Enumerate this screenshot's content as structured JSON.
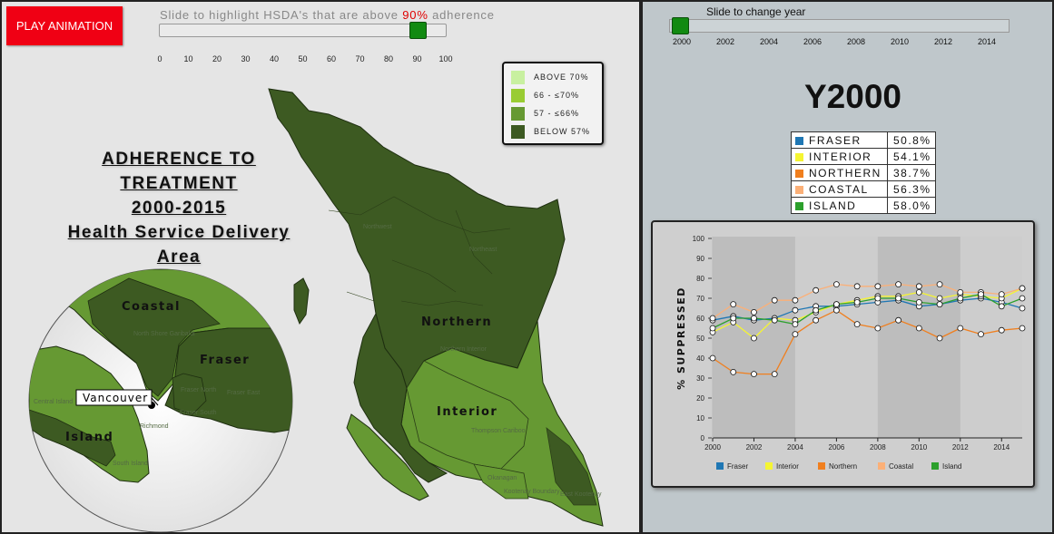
{
  "controls": {
    "play_label": "PLAY ANIMATION",
    "adherence_caption_pre": "Slide to highlight HSDA's that are above ",
    "adherence_caption_value": "90%",
    "adherence_caption_post": " adherence",
    "adherence_slider_value": 90,
    "adherence_ticks": [
      "0",
      "10",
      "20",
      "30",
      "40",
      "50",
      "60",
      "70",
      "80",
      "90",
      "100"
    ],
    "year_caption": "Slide to change year",
    "year_slider_value": 2000,
    "year_ticks": [
      "2000",
      "2002",
      "2004",
      "2006",
      "2008",
      "2010",
      "2012",
      "2014"
    ]
  },
  "legend": {
    "items": [
      {
        "label": "ABOVE 70%",
        "color": "#c8f0a0"
      },
      {
        "label": "66 - ≤70%",
        "color": "#99cc33"
      },
      {
        "label": "57 - ≤66%",
        "color": "#669933"
      },
      {
        "label": "BELOW 57%",
        "color": "#3d5a22"
      }
    ]
  },
  "map": {
    "title_lines": [
      "ADHERENCE TO",
      "TREATMENT",
      "2000-2015",
      "Health Service Delivery",
      "Area"
    ],
    "region_labels": {
      "northern": "Northern",
      "interior": "Interior",
      "coastal": "Coastal",
      "fraser": "Fraser",
      "island": "Island",
      "vancouver": "Vancouver"
    },
    "small_labels": [
      "Northwest",
      "Northeast",
      "Northern Interior",
      "Thompson Cariboo",
      "Okanagan",
      "Kootenay Boundary",
      "East Kootenay",
      "North Shore Garibaldi",
      "Fraser North",
      "Fraser East",
      "Fraser South",
      "Richmond",
      "Central Island",
      "South Island"
    ]
  },
  "year_display": "Y2000",
  "regions": [
    {
      "name": "FRASER",
      "value": "50.8%",
      "color": "#1f77b4"
    },
    {
      "name": "INTERIOR",
      "value": "54.1%",
      "color": "#f5f532"
    },
    {
      "name": "NORTHERN",
      "value": "38.7%",
      "color": "#f07f1e"
    },
    {
      "name": "COASTAL",
      "value": "56.3%",
      "color": "#fbb078"
    },
    {
      "name": "ISLAND",
      "value": "58.0%",
      "color": "#2ca02c"
    }
  ],
  "chart_data": {
    "type": "line",
    "ylabel": "% SUPPRESSED",
    "xlabel": "",
    "ylim": [
      0,
      100
    ],
    "xlim": [
      2000,
      2015
    ],
    "y_ticks": [
      0,
      10,
      20,
      30,
      40,
      50,
      60,
      70,
      80,
      90,
      100
    ],
    "x_ticks": [
      2000,
      2002,
      2004,
      2006,
      2008,
      2010,
      2012,
      2014
    ],
    "shaded_bands": [
      [
        2000,
        2004
      ],
      [
        2008,
        2012
      ]
    ],
    "x": [
      2000,
      2001,
      2002,
      2003,
      2004,
      2005,
      2006,
      2007,
      2008,
      2009,
      2010,
      2011,
      2012,
      2013,
      2014,
      2015
    ],
    "series": [
      {
        "name": "Fraser",
        "color": "#1f77b4",
        "values": [
          59,
          61,
          59,
          60,
          64,
          66,
          66,
          67,
          68,
          69,
          66,
          67,
          69,
          70,
          68,
          65
        ]
      },
      {
        "name": "Interior",
        "color": "#f5f532",
        "values": [
          53,
          58,
          50,
          60,
          59,
          63,
          67,
          69,
          71,
          71,
          73,
          70,
          72,
          71,
          70,
          75
        ]
      },
      {
        "name": "Northern",
        "color": "#f07f1e",
        "values": [
          40,
          33,
          32,
          32,
          52,
          59,
          64,
          57,
          55,
          59,
          55,
          50,
          55,
          52,
          54,
          55
        ]
      },
      {
        "name": "Coastal",
        "color": "#fbb078",
        "values": [
          60,
          67,
          63,
          69,
          69,
          74,
          77,
          76,
          76,
          77,
          76,
          77,
          73,
          73,
          72,
          75
        ]
      },
      {
        "name": "Island",
        "color": "#2ca02c",
        "values": [
          55,
          60,
          60,
          59,
          57,
          64,
          67,
          68,
          70,
          70,
          68,
          67,
          70,
          72,
          66,
          70
        ]
      }
    ],
    "legend_position": "bottom"
  }
}
